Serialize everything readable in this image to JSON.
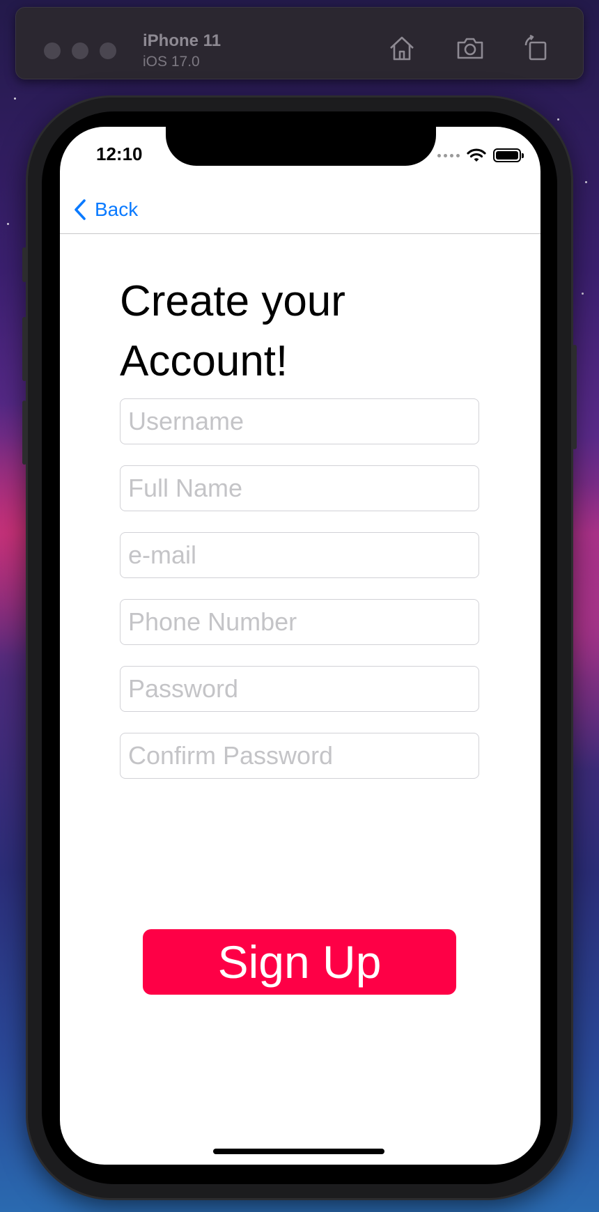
{
  "simulator": {
    "device_name": "iPhone 11",
    "os_version": "iOS 17.0",
    "toolbar_icons": [
      "home-icon",
      "camera-icon",
      "rotate-icon"
    ]
  },
  "status_bar": {
    "time": "12:10",
    "icons": [
      "cellular-dots-icon",
      "wifi-icon",
      "battery-icon"
    ]
  },
  "nav": {
    "back_label": "Back"
  },
  "page": {
    "title_line1": "Create your",
    "title_line2": "Account!"
  },
  "form": {
    "fields": [
      {
        "placeholder": "Username",
        "value": ""
      },
      {
        "placeholder": "Full Name",
        "value": ""
      },
      {
        "placeholder": "e-mail",
        "value": ""
      },
      {
        "placeholder": "Phone Number",
        "value": ""
      },
      {
        "placeholder": "Password",
        "value": ""
      },
      {
        "placeholder": "Confirm Password",
        "value": ""
      }
    ],
    "submit_label": "Sign Up"
  },
  "colors": {
    "accent_blue": "#0a7aff",
    "signup_button": "#fe0046",
    "placeholder": "#c4c4c7"
  }
}
